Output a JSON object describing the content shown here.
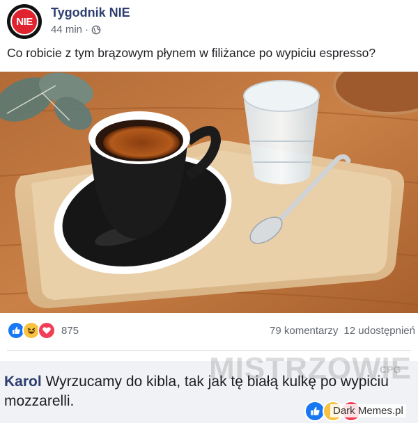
{
  "post": {
    "page_name": "Tygodnik NIE",
    "avatar_text": "NIE",
    "time": "44 min",
    "separator": "·",
    "privacy_icon": "globe-icon",
    "text": "Co robicie z tym brązowym płynem w filiżance po wypiciu espresso?",
    "image_icon": "espresso-photo"
  },
  "stats": {
    "reaction_icons": [
      "like-icon",
      "haha-icon",
      "love-icon"
    ],
    "reaction_count": "875",
    "comments": "79 komentarzy",
    "shares": "12 udostępnień"
  },
  "comment": {
    "author": "Karol",
    "text": "Wyrzucamy do kibla, tak jak tę białą kulkę po wypiciu mozzarelli.",
    "reaction_icons": [
      "like-icon",
      "haha-icon",
      "love-icon"
    ]
  },
  "watermark": {
    "text": "MISTRZOWIE",
    "suffix": "CPG",
    "site": "Dark Memes.pl"
  },
  "colors": {
    "link": "#2d3e70",
    "muted": "#606770",
    "comment_bg": "#f0f2f5",
    "like": "#1877f2",
    "love": "#f33e58",
    "haha": "#f7c23f"
  }
}
